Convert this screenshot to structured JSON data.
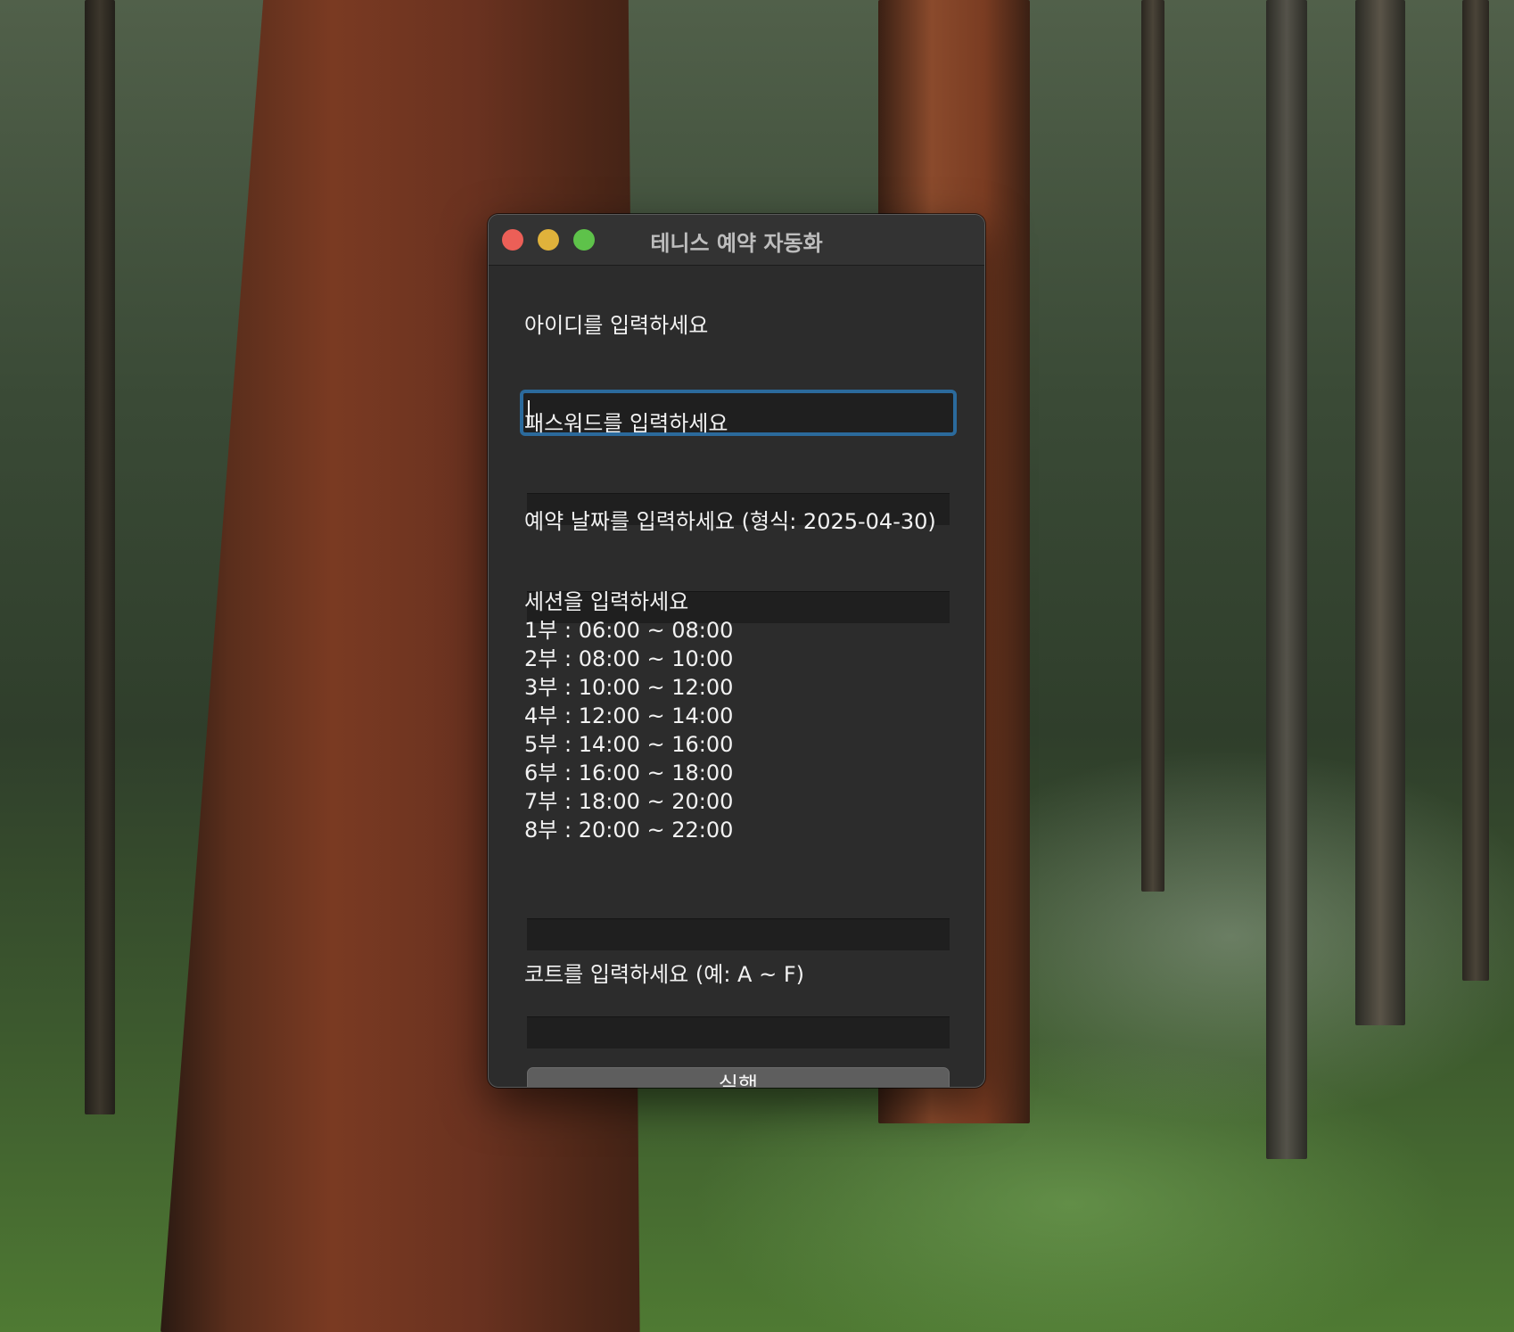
{
  "window": {
    "title": "테니스 예약 자동화"
  },
  "form": {
    "id_label": "아이디를 입력하세요",
    "id_value": "",
    "password_label": "패스워드를 입력하세요",
    "password_value": "",
    "date_label": "예약 날짜를 입력하세요 (형식: 2025-04-30)",
    "date_value": "",
    "session_label": "세션을 입력하세요",
    "sessions": [
      "1부 : 06:00 ~ 08:00",
      "2부 : 08:00 ~ 10:00",
      "3부 : 10:00 ~ 12:00",
      "4부 : 12:00 ~ 14:00",
      "5부 : 14:00 ~ 16:00",
      "6부 : 16:00 ~ 18:00",
      "7부 : 18:00 ~ 20:00",
      "8부 : 20:00 ~ 22:00"
    ],
    "session_value": "",
    "court_label": "코트를 입력하세요 (예: A ~ F)",
    "court_value": "",
    "run_button": "실행"
  },
  "colors": {
    "window_bg": "#2c2c2c",
    "field_bg": "#1f1f1f",
    "focus_ring": "#2b6a9c",
    "button_bg": "#5e5e5e",
    "close": "#ec5f57",
    "minimize": "#e0b23b",
    "maximize": "#5ec24a"
  }
}
